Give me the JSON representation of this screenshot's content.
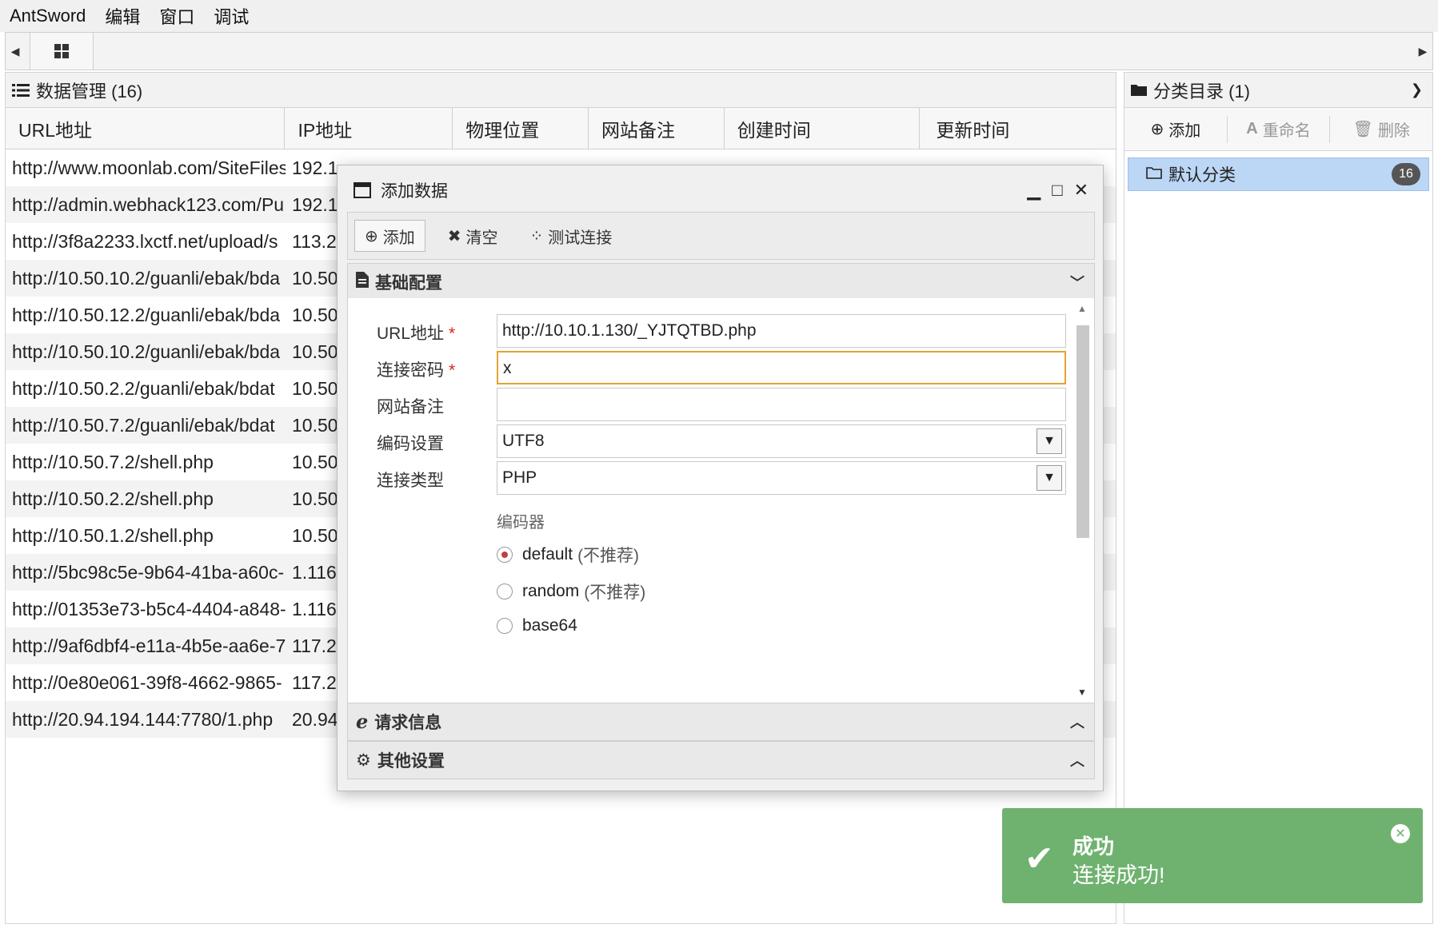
{
  "menubar": {
    "items": [
      "AntSword",
      "编辑",
      "窗口",
      "调试"
    ]
  },
  "left_panel": {
    "title": "数据管理 (16)",
    "columns": [
      "URL地址",
      "IP地址",
      "物理位置",
      "网站备注",
      "创建时间",
      "更新时间"
    ],
    "rows": [
      {
        "url": "http://www.moonlab.com/SiteFiles",
        "ip": "192.1"
      },
      {
        "url": "http://admin.webhack123.com/Pu",
        "ip": "192.1"
      },
      {
        "url": "http://3f8a2233.lxctf.net/upload/s",
        "ip": "113.2"
      },
      {
        "url": "http://10.50.10.2/guanli/ebak/bda",
        "ip": "10.50"
      },
      {
        "url": "http://10.50.12.2/guanli/ebak/bda",
        "ip": "10.50"
      },
      {
        "url": "http://10.50.10.2/guanli/ebak/bda",
        "ip": "10.50"
      },
      {
        "url": "http://10.50.2.2/guanli/ebak/bdat",
        "ip": "10.50"
      },
      {
        "url": "http://10.50.7.2/guanli/ebak/bdat",
        "ip": "10.50"
      },
      {
        "url": "http://10.50.7.2/shell.php",
        "ip": "10.50"
      },
      {
        "url": "http://10.50.2.2/shell.php",
        "ip": "10.50"
      },
      {
        "url": "http://10.50.1.2/shell.php",
        "ip": "10.50"
      },
      {
        "url": "http://5bc98c5e-9b64-41ba-a60c-",
        "ip": "1.116"
      },
      {
        "url": "http://01353e73-b5c4-4404-a848-",
        "ip": "1.116"
      },
      {
        "url": "http://9af6dbf4-e11a-4b5e-aa6e-7",
        "ip": "117.2"
      },
      {
        "url": "http://0e80e061-39f8-4662-9865-",
        "ip": "117.2"
      },
      {
        "url": "http://20.94.194.144:7780/1.php",
        "ip": "20.94"
      }
    ]
  },
  "right_panel": {
    "title": "分类目录 (1)",
    "toolbar": {
      "add": "添加",
      "rename": "重命名",
      "delete": "删除"
    },
    "category": {
      "label": "默认分类",
      "count": "16"
    }
  },
  "modal": {
    "title": "添加数据",
    "toolbar": {
      "add": "添加",
      "clear": "清空",
      "test": "测试连接"
    },
    "section_basic": "基础配置",
    "fields": {
      "url_label": "URL地址",
      "url_value": "http://10.10.1.130/_YJTQTBD.php",
      "password_label": "连接密码",
      "password_value": "x",
      "note_label": "网站备注",
      "note_value": "",
      "encoding_label": "编码设置",
      "encoding_value": "UTF8",
      "type_label": "连接类型",
      "type_value": "PHP"
    },
    "encoder_heading": "编码器",
    "encoders": [
      {
        "name": "default",
        "note": "(不推荐)",
        "selected": true
      },
      {
        "name": "random",
        "note": "(不推荐)",
        "selected": false
      },
      {
        "name": "base64",
        "note": "",
        "selected": false
      }
    ],
    "section_request": "请求信息",
    "section_other": "其他设置"
  },
  "toast": {
    "title": "成功",
    "message": "连接成功!"
  },
  "colors": {
    "toast_bg": "#6fb26f",
    "focus_border": "#e3a432",
    "selection": "#bcd6f5",
    "required": "#e02020"
  }
}
